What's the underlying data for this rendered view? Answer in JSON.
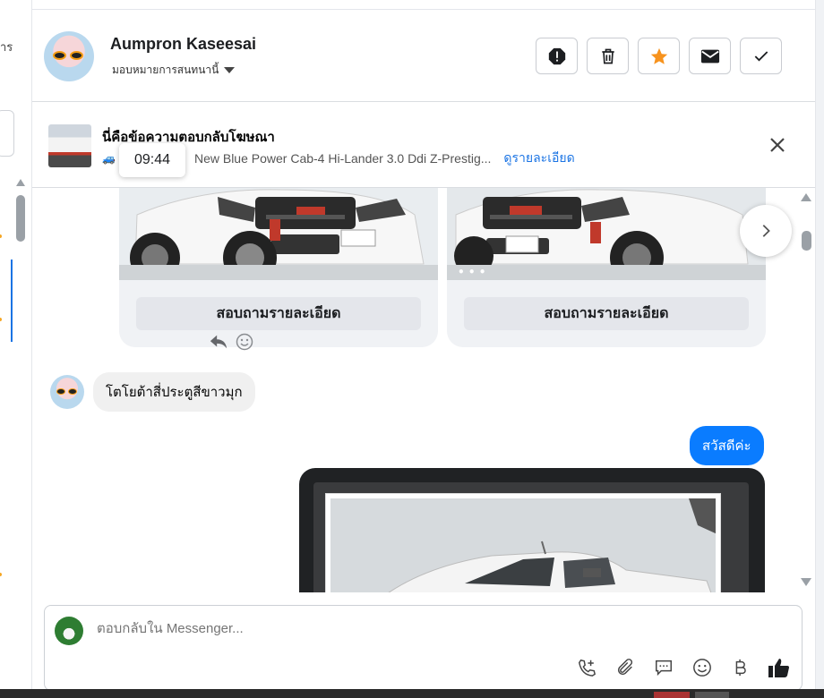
{
  "left_panel": {
    "text_fragment": "าร"
  },
  "header": {
    "contact_name": "Aumpron Kaseesai",
    "assign_label": "มอบหมายการสนทนานี้",
    "actions": [
      "spam-icon",
      "trash-icon",
      "star-icon",
      "mail-icon",
      "check-icon"
    ]
  },
  "ad": {
    "title": "นี่คือข้อความตอบกลับโฆษณา",
    "subtitle": "New Blue Power Cab-4 Hi-Lander 3.0 Ddi Z-Prestig...",
    "link": "ดูรายละเอียด",
    "tooltip_time": "09:44"
  },
  "conversation": {
    "cards": [
      {
        "button": "สอบถามรายละเอียด"
      },
      {
        "button": "สอบถามรายละเอียด"
      }
    ],
    "incoming_message": "โตโยต้าสี่ประตูสีขาวมุก",
    "outgoing_message": "สวัสดีค่ะ"
  },
  "composer": {
    "placeholder": "ตอบกลับใน Messenger...",
    "tools": [
      "add-call-icon",
      "attach-icon",
      "saved-replies-icon",
      "emoji-icon",
      "baht-icon",
      "like-icon"
    ]
  },
  "colors": {
    "accent": "#0a7cff",
    "link": "#1b74e4",
    "star": "#f7931e"
  }
}
